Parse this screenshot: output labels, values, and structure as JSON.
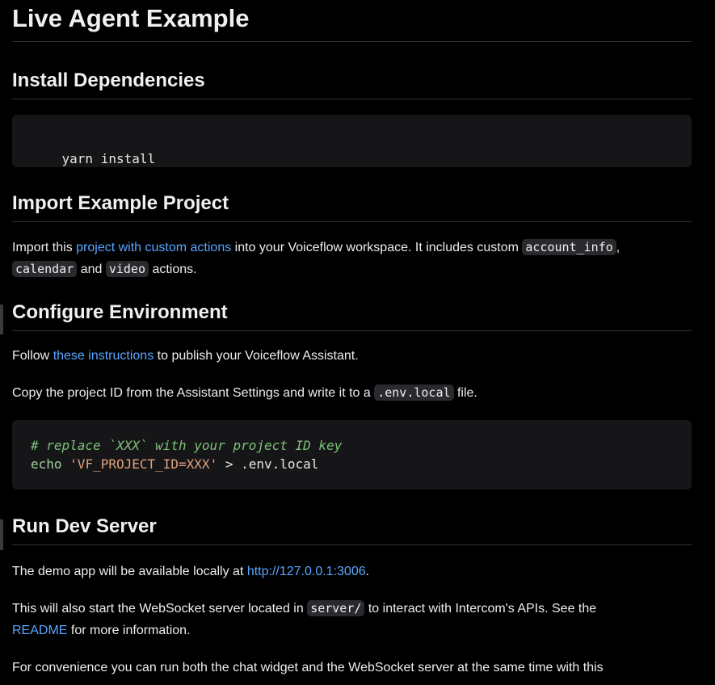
{
  "title": "Live Agent Example",
  "sections": {
    "install": {
      "heading": "Install Dependencies",
      "code": "yarn install"
    },
    "import": {
      "heading": "Import Example Project",
      "text1": "Import this ",
      "link": "project with custom actions",
      "text2": " into your Voiceflow workspace. It includes custom ",
      "code1": "account_info",
      "text3": ",",
      "code2": "calendar",
      "text4": " and ",
      "code3": "video",
      "text5": " actions."
    },
    "configure": {
      "heading": "Configure Environment",
      "p1_text1": "Follow ",
      "p1_link": "these instructions",
      "p1_text2": " to publish your Voiceflow Assistant.",
      "p2_text1": "Copy the project ID from the Assistant Settings and write it to a ",
      "p2_code": ".env.local",
      "p2_text2": " file.",
      "code_comment": "# replace `XXX` with your project ID key",
      "code_cmd": "echo",
      "code_str": "'VF_PROJECT_ID=XXX'",
      "code_rest": " > .env.local"
    },
    "run": {
      "heading": "Run Dev Server",
      "p1_text1": "The demo app will be available locally at ",
      "p1_link": "http://127.0.0.1:3006",
      "p1_text2": ".",
      "p2_text1": "This will also start the WebSocket server located in ",
      "p2_code": "server/",
      "p2_text2": " to interact with Intercom's APIs. See the",
      "p2_link": "README",
      "p2_text3": " for more information.",
      "p3_text": "For convenience you can run both the chat widget and the WebSocket server at the same time with this"
    }
  },
  "colors": {
    "background": "#000000",
    "link": "#58a6ff",
    "divider": "#30363d",
    "codeblock": "#161618"
  }
}
